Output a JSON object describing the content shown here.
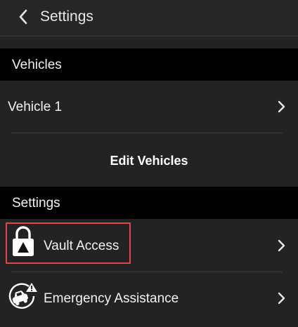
{
  "header": {
    "title": "Settings"
  },
  "vehicles_section": {
    "title": "Vehicles",
    "items": [
      {
        "label": "Vehicle 1"
      }
    ],
    "edit_label": "Edit Vehicles"
  },
  "settings_section": {
    "title": "Settings",
    "items": [
      {
        "label": "Vault Access",
        "icon": "lock-warning-icon"
      },
      {
        "label": "Emergency Assistance",
        "icon": "car-crash-warning-icon"
      }
    ]
  },
  "colors": {
    "background": "#232323",
    "section_header": "#000000",
    "highlight": "#e0474c"
  }
}
